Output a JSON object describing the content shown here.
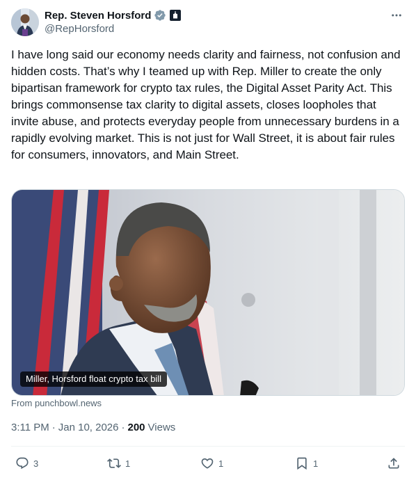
{
  "author": {
    "display_name": "Rep. Steven Horsford",
    "handle": "@RepHorsford",
    "verified_icon": "verified-badge-icon",
    "affiliation_icon": "government-affiliation-icon"
  },
  "tweet": {
    "text": "I have long said our economy needs clarity and fairness, not confusion and hidden costs. That’s why I teamed up with Rep. Miller to create the only bipartisan framework for crypto tax rules, the Digital Asset Parity Act. This brings commonsense tax clarity to digital assets, closes loopholes that invite abuse, and protects everyday people from unnecessary burdens in a rapidly evolving market. This is not just for Wall Street, it is about fair rules for consumers, innovators, and Main Street.",
    "card": {
      "caption": "Miller, Horsford float crypto tax bill",
      "source": "From punchbowl.news"
    },
    "time": "3:11 PM",
    "separator": "·",
    "date": "Jan 10, 2026",
    "views_count": "200",
    "views_label": "Views"
  },
  "actions": {
    "replies": "3",
    "reposts": "1",
    "likes": "1",
    "bookmarks": "1"
  },
  "colors": {
    "text_primary": "#0f1419",
    "text_secondary": "#536471",
    "verified_badge": "#829aab",
    "divider": "#eff3f4"
  }
}
